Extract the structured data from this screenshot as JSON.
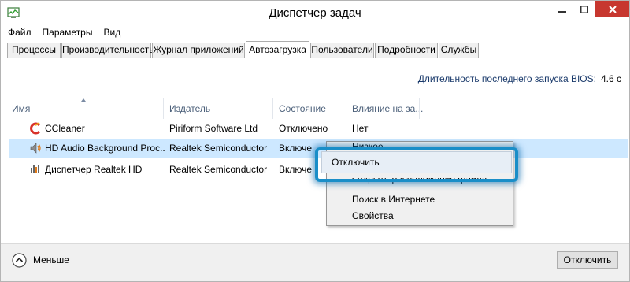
{
  "window": {
    "title": "Диспетчер задач",
    "controls": {
      "minimize": "minimize-icon",
      "maximize": "maximize-icon",
      "close": "close-icon"
    }
  },
  "menu": [
    "Файл",
    "Параметры",
    "Вид"
  ],
  "tabs": [
    {
      "label": "Процессы",
      "active": false
    },
    {
      "label": "Производительность",
      "active": false
    },
    {
      "label": "Журнал приложений",
      "active": false
    },
    {
      "label": "Автозагрузка",
      "active": true
    },
    {
      "label": "Пользователи",
      "active": false
    },
    {
      "label": "Подробности",
      "active": false
    },
    {
      "label": "Службы",
      "active": false
    }
  ],
  "bios": {
    "label": "Длительность последнего запуска BIOS:",
    "value": "4.6 с"
  },
  "columns": [
    "Имя",
    "Издатель",
    "Состояние",
    "Влияние на за..."
  ],
  "rows": [
    {
      "name": "CCleaner",
      "publisher": "Piriform Software Ltd",
      "state": "Отключено",
      "impact": "Нет",
      "icon": "ccleaner-icon",
      "selected": false
    },
    {
      "name": "HD Audio Background Proc...",
      "publisher": "Realtek Semiconductor",
      "state": "Включе",
      "impact": "",
      "icon": "speaker-icon",
      "selected": true
    },
    {
      "name": "Диспетчер Realtek HD",
      "publisher": "Realtek Semiconductor",
      "state": "Включе",
      "impact": "",
      "icon": "audio-manager-icon",
      "selected": false
    }
  ],
  "context_menu": {
    "items": [
      "Низкое",
      "Отключить",
      "Открыть расположение файла",
      "Поиск в Интернете",
      "Свойства"
    ],
    "highlighted": "Отключить"
  },
  "footer": {
    "less_label": "Меньше",
    "disable_button": "Отключить"
  },
  "colors": {
    "selection": "#cde8ff",
    "highlight_ring": "#1a8ec8",
    "close_button": "#c7372f"
  }
}
